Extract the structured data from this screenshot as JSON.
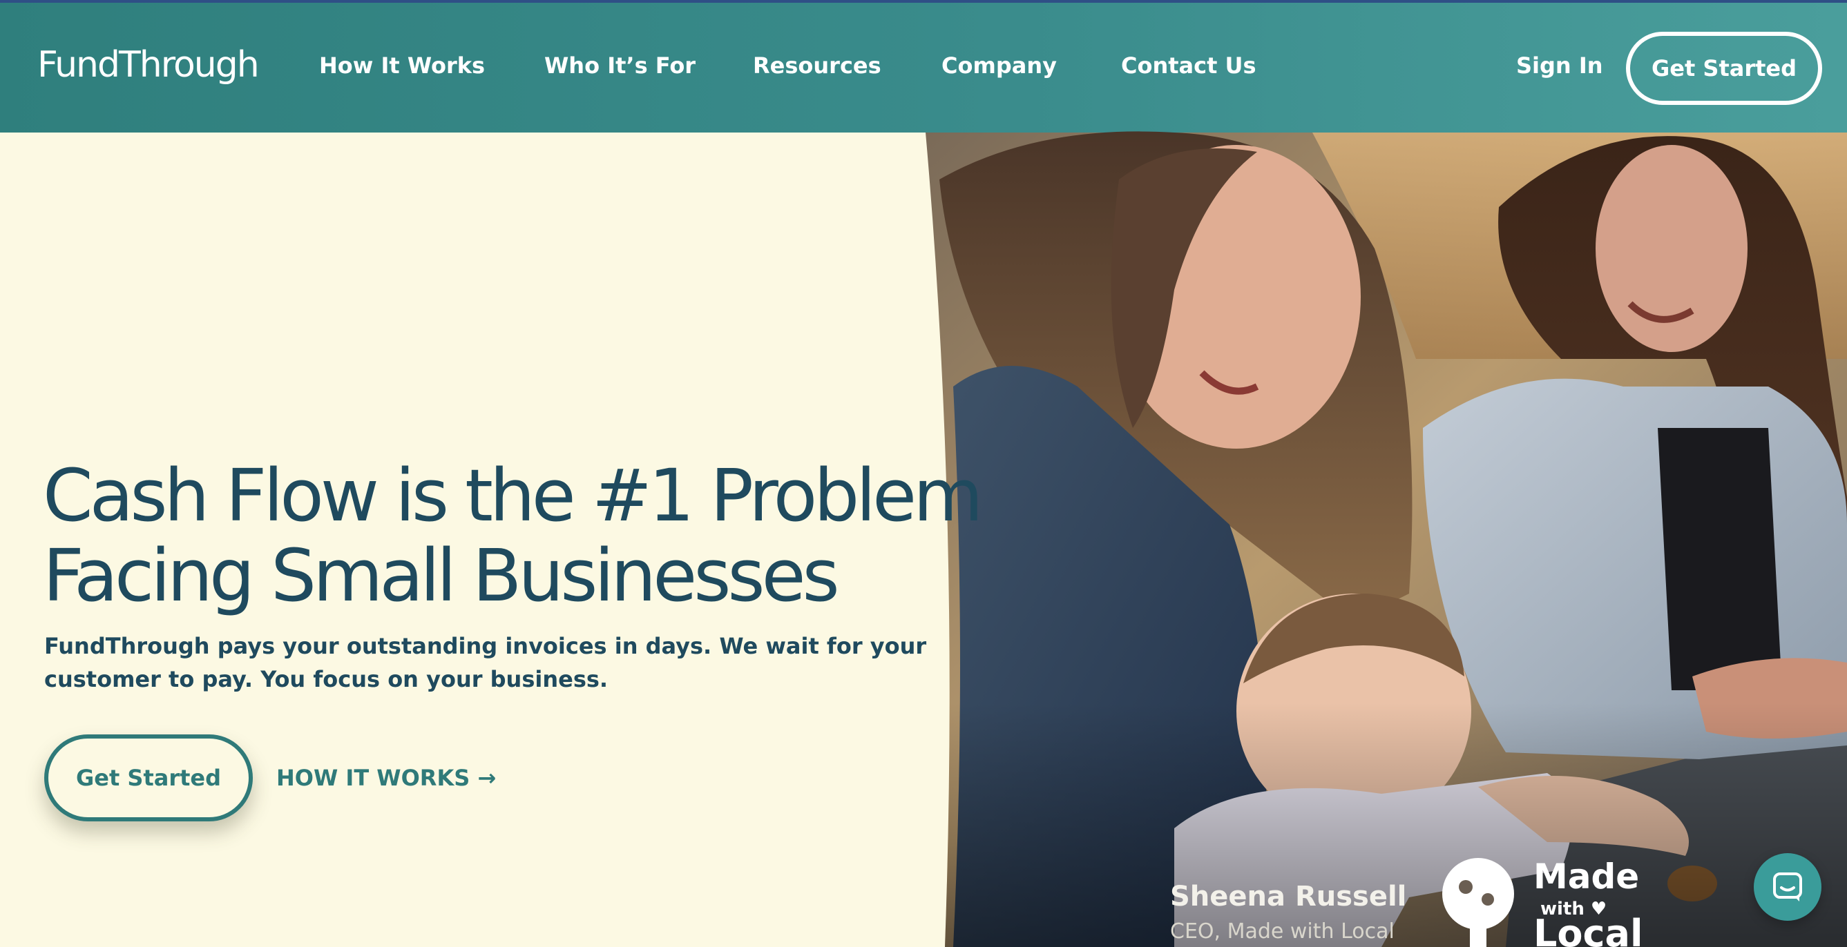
{
  "nav": {
    "logo": "FundThrough",
    "links": [
      "How It Works",
      "Who It’s For",
      "Resources",
      "Company",
      "Contact Us"
    ],
    "sign_in": "Sign In",
    "get_started": "Get Started"
  },
  "hero": {
    "title_line1": "Cash Flow is the #1 Problem",
    "title_line2": "Facing Small Businesses",
    "subtitle": "FundThrough pays your outstanding invoices in days. We wait for your customer to pay. You focus on your business.",
    "cta_primary": "Get Started",
    "cta_secondary": "HOW IT WORKS →"
  },
  "photo_caption": {
    "name": "Sheena Russell",
    "role": "CEO, Made with Local",
    "brand_logo_text": "Made with Local"
  },
  "colors": {
    "nav_teal": "#2f7f7d",
    "hero_background": "#fcf9e3",
    "heading_navy": "#1f4a5e",
    "accent_teal": "#2f7a79",
    "chat_button": "#3a9c9a"
  },
  "icons": {
    "chat": "chat-bubble-icon"
  }
}
